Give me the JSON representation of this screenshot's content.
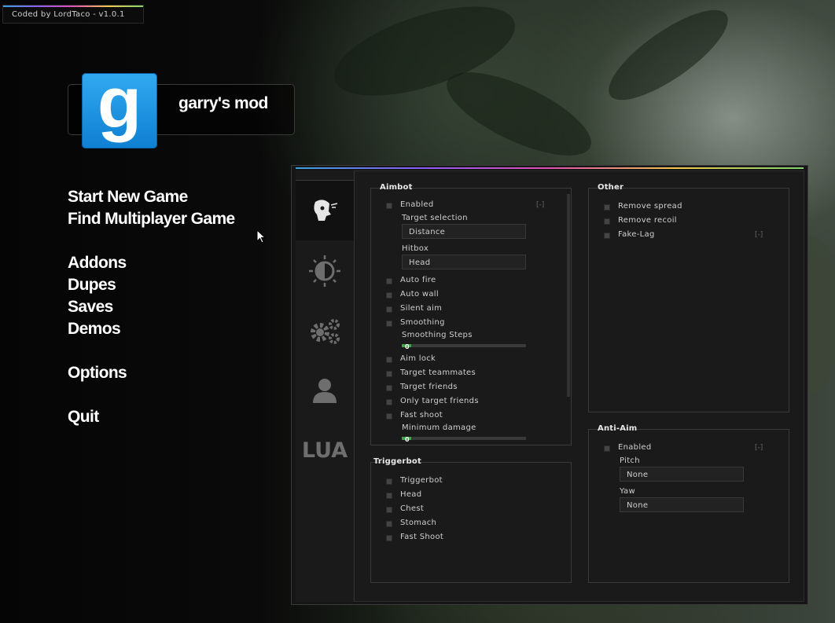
{
  "version_badge": "Coded by LordTaco - v1.0.1",
  "logo": {
    "glyph": "g",
    "title": "garry's mod"
  },
  "menu": {
    "start_new_game": "Start New Game",
    "find_multiplayer": "Find Multiplayer Game",
    "addons": "Addons",
    "dupes": "Dupes",
    "saves": "Saves",
    "demos": "Demos",
    "options": "Options",
    "quit": "Quit"
  },
  "cheat": {
    "tabs": [
      "aimbot-icon",
      "visuals-icon",
      "settings-icon",
      "player-icon",
      "LUA"
    ],
    "lua_label": "LUA",
    "aimbot": {
      "title": "Aimbot",
      "enabled": "Enabled",
      "enabled_key": "[-]",
      "target_selection_label": "Target selection",
      "target_selection_value": "Distance",
      "hitbox_label": "Hitbox",
      "hitbox_value": "Head",
      "auto_fire": "Auto fire",
      "auto_wall": "Auto wall",
      "silent_aim": "Silent aim",
      "smoothing": "Smoothing",
      "smoothing_steps_label": "Smoothing Steps",
      "smoothing_steps_value": "0",
      "aim_lock": "Aim lock",
      "target_teammates": "Target teammates",
      "target_friends": "Target friends",
      "only_target_friends": "Only target friends",
      "fast_shoot": "Fast shoot",
      "minimum_damage_label": "Minimum damage",
      "minimum_damage_value": "0"
    },
    "triggerbot": {
      "title": "Triggerbot",
      "items": [
        "Triggerbot",
        "Head",
        "Chest",
        "Stomach",
        "Fast Shoot"
      ]
    },
    "other": {
      "title": "Other",
      "remove_spread": "Remove spread",
      "remove_recoil": "Remove recoil",
      "fake_lag": "Fake-Lag",
      "fake_lag_key": "[-]"
    },
    "anti_aim": {
      "title": "Anti-Aim",
      "enabled": "Enabled",
      "enabled_key": "[-]",
      "pitch_label": "Pitch",
      "pitch_value": "None",
      "yaw_label": "Yaw",
      "yaw_value": "None"
    }
  },
  "colors": {
    "accent_green": "#3fa34a",
    "logo_blue": "#1e90e0"
  }
}
